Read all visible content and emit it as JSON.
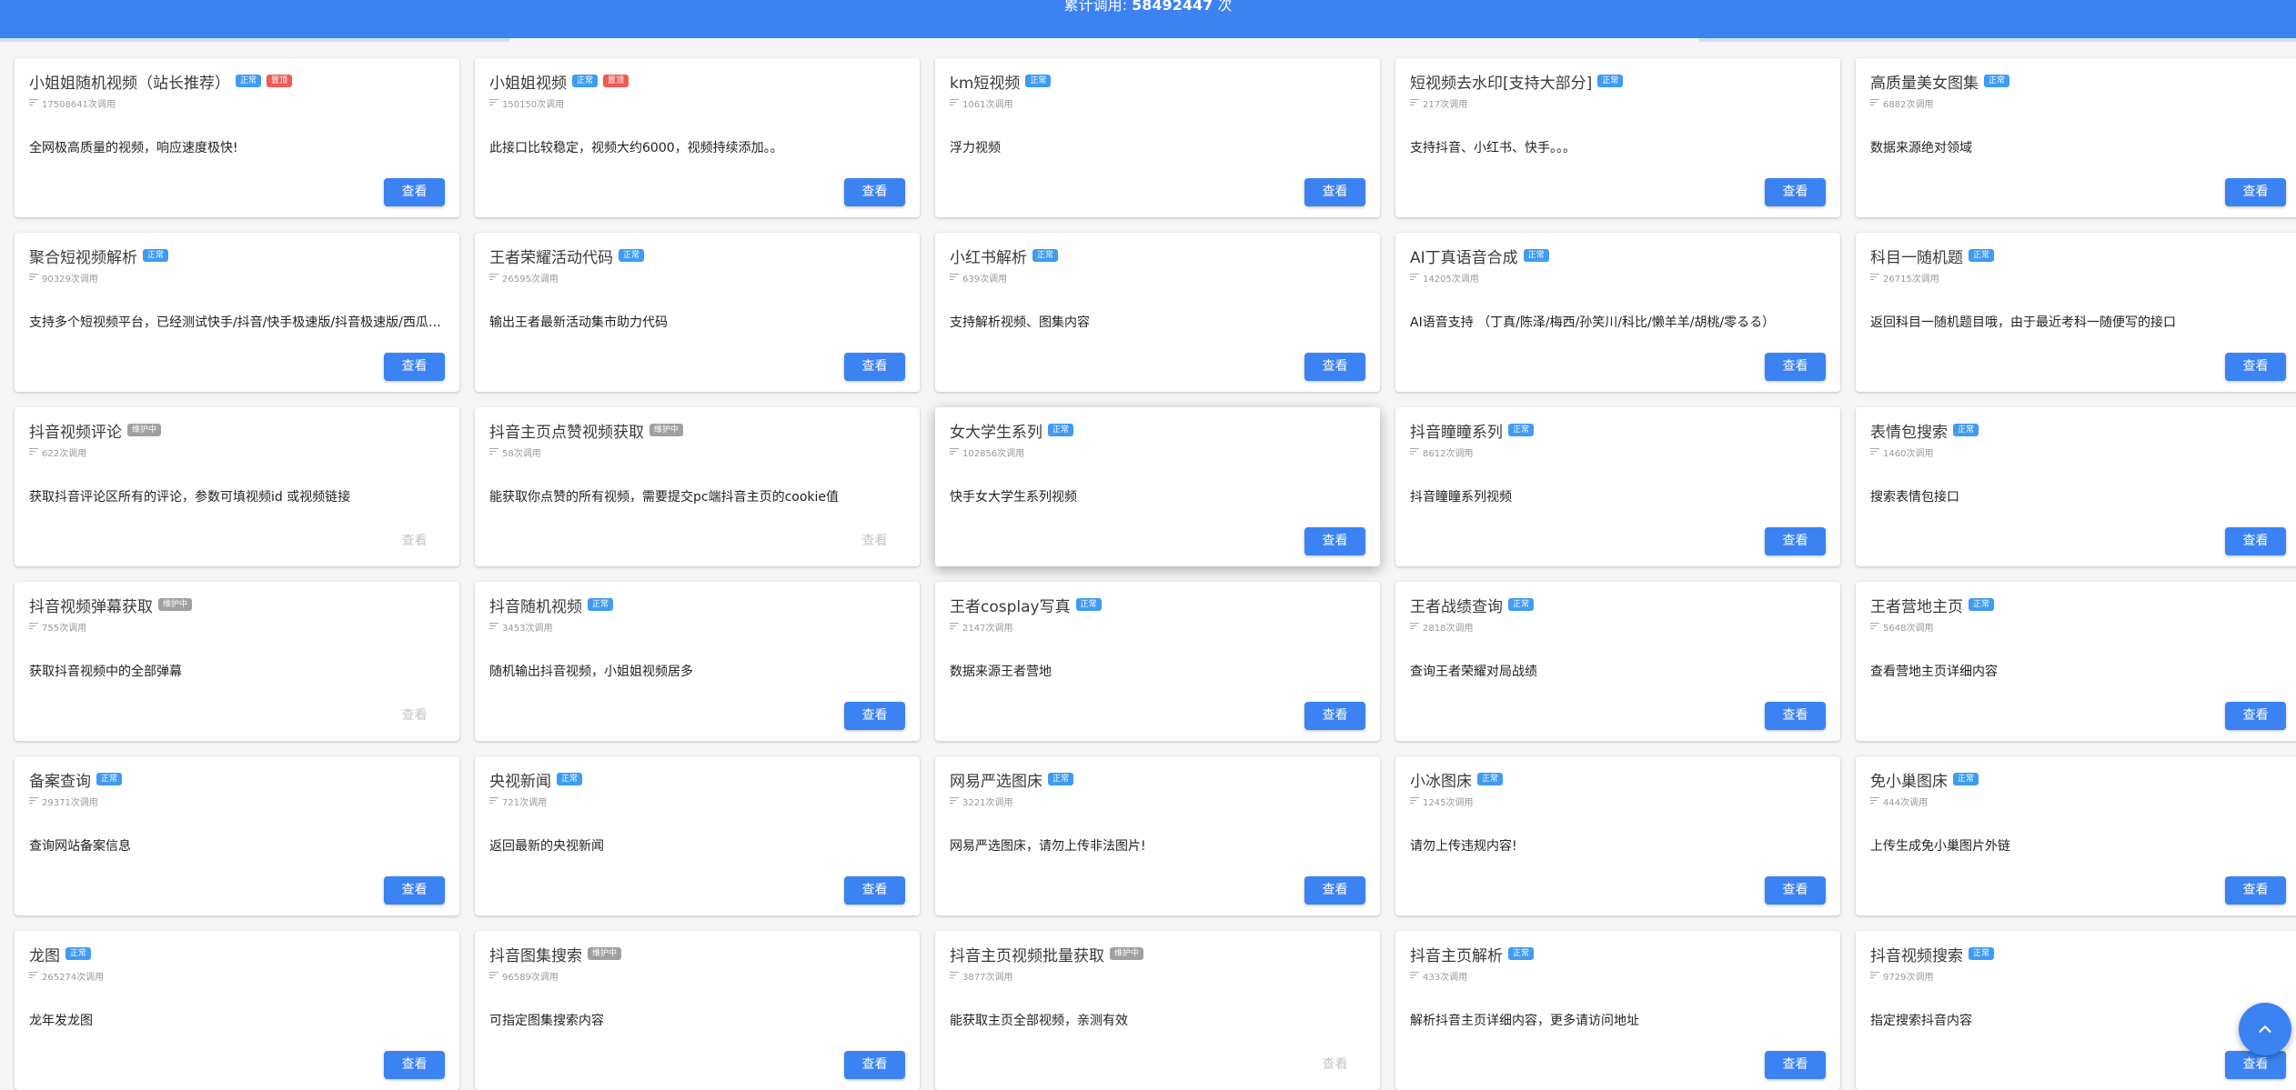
{
  "header": {
    "stat_label": "累计调用:",
    "stat_value": "58492447",
    "stat_unit": "次"
  },
  "colors": {
    "primary": "#3b82f3",
    "badge_normal": "#3f9bf3",
    "badge_hot": "#ee5b55",
    "badge_maintenance": "#a0a0a0"
  },
  "view_label": "查看",
  "cards": [
    {
      "title": "小姐姐随机视频（站长推荐）",
      "badges": [
        {
          "text": "正常",
          "color": "blue"
        },
        {
          "text": "置顶",
          "color": "red"
        }
      ],
      "count": "17508641次调用",
      "desc": "全网极高质量的视频，响应速度极快!",
      "button_enabled": true
    },
    {
      "title": "小姐姐视频",
      "badges": [
        {
          "text": "正常",
          "color": "blue"
        },
        {
          "text": "置顶",
          "color": "red"
        }
      ],
      "count": "150150次调用",
      "desc": "此接口比较稳定，视频大约6000，视频持续添加。。",
      "button_enabled": true
    },
    {
      "title": "km短视频",
      "badges": [
        {
          "text": "正常",
          "color": "blue"
        }
      ],
      "count": "1061次调用",
      "desc": "浮力视频",
      "button_enabled": true
    },
    {
      "title": "短视频去水印[支持大部分]",
      "badges": [
        {
          "text": "正常",
          "color": "blue"
        }
      ],
      "count": "217次调用",
      "desc": "支持抖音、小红书、快手。。。",
      "button_enabled": true
    },
    {
      "title": "高质量美女图集",
      "badges": [
        {
          "text": "正常",
          "color": "blue"
        }
      ],
      "count": "6882次调用",
      "desc": "数据来源绝对领域",
      "button_enabled": true
    },
    {
      "title": "聚合短视频解析",
      "badges": [
        {
          "text": "正常",
          "color": "blue"
        }
      ],
      "count": "90329次调用",
      "desc": "支持多个短视频平台，已经测试快手/抖音/快手极速版/抖音极速版/西瓜视频",
      "button_enabled": true
    },
    {
      "title": "王者荣耀活动代码",
      "badges": [
        {
          "text": "正常",
          "color": "blue"
        }
      ],
      "count": "26595次调用",
      "desc": "输出王者最新活动集市助力代码",
      "button_enabled": true
    },
    {
      "title": "小红书解析",
      "badges": [
        {
          "text": "正常",
          "color": "blue"
        }
      ],
      "count": "639次调用",
      "desc": "支持解析视频、图集内容",
      "button_enabled": true
    },
    {
      "title": "AI丁真语音合成",
      "badges": [
        {
          "text": "正常",
          "color": "blue"
        }
      ],
      "count": "14205次调用",
      "desc": "AI语音支持 （丁真/陈泽/梅西/孙笑川/科比/懒羊羊/胡桃/零るる）",
      "button_enabled": true
    },
    {
      "title": "科目一随机题",
      "badges": [
        {
          "text": "正常",
          "color": "blue"
        }
      ],
      "count": "26715次调用",
      "desc": "返回科目一随机题目哦，由于最近考科一随便写的接口",
      "button_enabled": true
    },
    {
      "title": "抖音视频评论",
      "badges": [
        {
          "text": "维护中",
          "color": "gray"
        }
      ],
      "count": "622次调用",
      "desc": "获取抖音评论区所有的评论，参数可填视频id 或视频链接",
      "button_enabled": false
    },
    {
      "title": "抖音主页点赞视频获取",
      "badges": [
        {
          "text": "维护中",
          "color": "gray"
        }
      ],
      "count": "58次调用",
      "desc": "能获取你点赞的所有视频，需要提交pc端抖音主页的cookie值",
      "button_enabled": false
    },
    {
      "title": "女大学生系列",
      "badges": [
        {
          "text": "正常",
          "color": "blue"
        }
      ],
      "count": "102856次调用",
      "desc": "快手女大学生系列视频",
      "button_enabled": true,
      "raised": true
    },
    {
      "title": "抖音瞳瞳系列",
      "badges": [
        {
          "text": "正常",
          "color": "blue"
        }
      ],
      "count": "8612次调用",
      "desc": "抖音瞳瞳系列视频",
      "button_enabled": true
    },
    {
      "title": "表情包搜索",
      "badges": [
        {
          "text": "正常",
          "color": "blue"
        }
      ],
      "count": "1460次调用",
      "desc": "搜索表情包接口",
      "button_enabled": true
    },
    {
      "title": "抖音视频弹幕获取",
      "badges": [
        {
          "text": "维护中",
          "color": "gray"
        }
      ],
      "count": "755次调用",
      "desc": "获取抖音视频中的全部弹幕",
      "button_enabled": false
    },
    {
      "title": "抖音随机视频",
      "badges": [
        {
          "text": "正常",
          "color": "blue"
        }
      ],
      "count": "3453次调用",
      "desc": "随机输出抖音视频，小姐姐视频居多",
      "button_enabled": true
    },
    {
      "title": "王者cosplay写真",
      "badges": [
        {
          "text": "正常",
          "color": "blue"
        }
      ],
      "count": "2147次调用",
      "desc": "数据来源王者营地",
      "button_enabled": true
    },
    {
      "title": "王者战绩查询",
      "badges": [
        {
          "text": "正常",
          "color": "blue"
        }
      ],
      "count": "2818次调用",
      "desc": "查询王者荣耀对局战绩",
      "button_enabled": true
    },
    {
      "title": "王者营地主页",
      "badges": [
        {
          "text": "正常",
          "color": "blue"
        }
      ],
      "count": "5648次调用",
      "desc": "查看营地主页详细内容",
      "button_enabled": true
    },
    {
      "title": "备案查询",
      "badges": [
        {
          "text": "正常",
          "color": "blue"
        }
      ],
      "count": "29371次调用",
      "desc": "查询网站备案信息",
      "button_enabled": true
    },
    {
      "title": "央视新闻",
      "badges": [
        {
          "text": "正常",
          "color": "blue"
        }
      ],
      "count": "721次调用",
      "desc": "返回最新的央视新闻",
      "button_enabled": true
    },
    {
      "title": "网易严选图床",
      "badges": [
        {
          "text": "正常",
          "color": "blue"
        }
      ],
      "count": "3221次调用",
      "desc": "网易严选图床，请勿上传非法图片!",
      "button_enabled": true
    },
    {
      "title": "小冰图床",
      "badges": [
        {
          "text": "正常",
          "color": "blue"
        }
      ],
      "count": "1245次调用",
      "desc": "请勿上传违规内容!",
      "button_enabled": true
    },
    {
      "title": "免小巢图床",
      "badges": [
        {
          "text": "正常",
          "color": "blue"
        }
      ],
      "count": "444次调用",
      "desc": "上传生成免小巢图片外链",
      "button_enabled": true
    },
    {
      "title": "龙图",
      "badges": [
        {
          "text": "正常",
          "color": "blue"
        }
      ],
      "count": "265274次调用",
      "desc": "龙年发龙图",
      "button_enabled": true
    },
    {
      "title": "抖音图集搜索",
      "badges": [
        {
          "text": "维护中",
          "color": "gray"
        }
      ],
      "count": "96589次调用",
      "desc": "可指定图集搜索内容",
      "button_enabled": true
    },
    {
      "title": "抖音主页视频批量获取",
      "badges": [
        {
          "text": "维护中",
          "color": "gray"
        }
      ],
      "count": "3877次调用",
      "desc": "能获取主页全部视频，亲测有效",
      "button_enabled": false
    },
    {
      "title": "抖音主页解析",
      "badges": [
        {
          "text": "正常",
          "color": "blue"
        }
      ],
      "count": "433次调用",
      "desc": "解析抖音主页详细内容，更多请访问地址",
      "button_enabled": true
    },
    {
      "title": "抖音视频搜索",
      "badges": [
        {
          "text": "正常",
          "color": "blue"
        }
      ],
      "count": "9729次调用",
      "desc": "指定搜索抖音内容",
      "button_enabled": true
    }
  ]
}
